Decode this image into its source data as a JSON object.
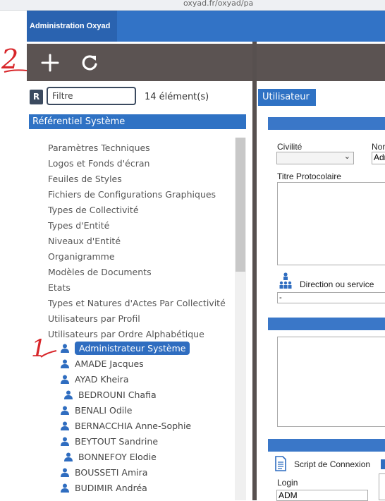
{
  "browser": {
    "url_fragment": "oxyad.fr/oxyad/pa"
  },
  "app": {
    "title": "Administration Oxyad"
  },
  "toolbar": {
    "add_icon": "plus-icon",
    "refresh_icon": "refresh-icon"
  },
  "annotations": {
    "one": "1",
    "two": "2"
  },
  "filter": {
    "badge": "R",
    "placeholder": "Filtre",
    "count": "14 élément(s)"
  },
  "tree": {
    "header": "Référentiel Système",
    "categories": [
      "Paramètres Techniques",
      "Logos et Fonds d'écran",
      "Feuiles de Styles",
      "Fichiers de Configurations Graphiques",
      "Types de Collectivité",
      "Types d'Entité",
      "Niveaux d'Entité",
      "Organigramme",
      "Modèles de Documents",
      "Etats",
      "Types et Natures d'Actes Par Collectivité",
      "Utilisateurs par Profil",
      "Utilisateurs par Ordre Alphabétique"
    ],
    "users": [
      "Administrateur Système",
      "AMADE Jacques",
      "AYAD Kheira",
      "BEDROUNI Chafia",
      "BENALI Odile",
      "BERNACCHIA Anne-Sophie",
      "BEYTOUT Sandrine",
      "BONNEFOY Elodie",
      "BOUSSETI Amira",
      "BUDIMIR Andréa"
    ],
    "selected_user": "Administrateur Système"
  },
  "form": {
    "tab": "Utilisateur",
    "civilite_label": "Civilité",
    "nom_label": "Nor",
    "nom_value": "Adr",
    "titre_label": "Titre Protocolaire",
    "direction_label": "Direction ou service",
    "direction_value": "-",
    "script_label": "Script de Connexion",
    "login_label": "Login",
    "login_value": "ADM"
  },
  "colors": {
    "app_bar": "#3273c6",
    "toolbar": "#5b5352",
    "selection": "#2f6dc0",
    "annotation": "#d8262a"
  }
}
